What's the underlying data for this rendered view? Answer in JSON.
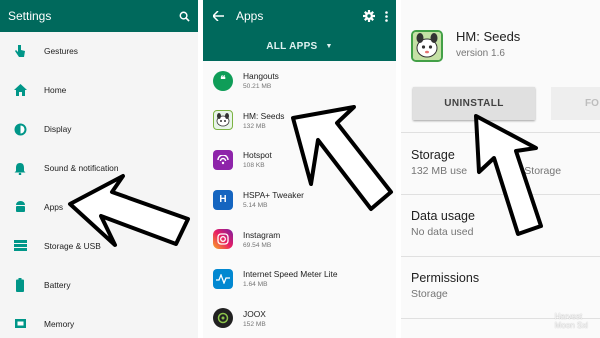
{
  "colors": {
    "toolbar": "#00695c",
    "accent": "#009688",
    "arrow_fill": "#ffffff",
    "arrow_stroke": "#000000"
  },
  "settings": {
    "title": "Settings",
    "search_icon": "search-icon",
    "items": [
      {
        "label": "Gestures",
        "icon": "gesture-hand-icon"
      },
      {
        "label": "Home",
        "icon": "home-icon"
      },
      {
        "label": "Display",
        "icon": "brightness-icon"
      },
      {
        "label": "Sound & notification",
        "icon": "bell-icon"
      },
      {
        "label": "Apps",
        "icon": "android-icon"
      },
      {
        "label": "Storage & USB",
        "icon": "storage-icon"
      },
      {
        "label": "Battery",
        "icon": "battery-icon"
      },
      {
        "label": "Memory",
        "icon": "memory-icon"
      }
    ]
  },
  "apps": {
    "title": "Apps",
    "filter": "ALL APPS",
    "items": [
      {
        "name": "Hangouts",
        "size": "50.21 MB",
        "icon": "hangouts-icon",
        "color": "#0f9d58"
      },
      {
        "name": "HM: Seeds",
        "size": "132 MB",
        "icon": "hm-seeds-icon",
        "color": "#7cb342"
      },
      {
        "name": "Hotspot",
        "size": "108 KB",
        "icon": "hotspot-icon",
        "color": "#8e24aa"
      },
      {
        "name": "HSPA+ Tweaker",
        "size": "5.14 MB",
        "icon": "hspa-tweaker-icon",
        "color": "#1565c0"
      },
      {
        "name": "Instagram",
        "size": "69.54 MB",
        "icon": "instagram-icon",
        "color": "#c13584"
      },
      {
        "name": "Internet Speed Meter Lite",
        "size": "1.64 MB",
        "icon": "speed-meter-icon",
        "color": "#0288d1"
      },
      {
        "name": "JOOX",
        "size": "152 MB",
        "icon": "joox-icon",
        "color": "#212121"
      }
    ]
  },
  "app_info": {
    "name": "HM: Seeds",
    "version": "version 1.6",
    "uninstall_label": "UNINSTALL",
    "force_stop_label": "FO",
    "storage_title": "Storage",
    "storage_value": "132 MB use",
    "storage_tail": "l Storage",
    "data_usage_title": "Data usage",
    "data_usage_value": "No data used",
    "permissions_title": "Permissions",
    "permissions_value": "Storage"
  },
  "watermark": {
    "line1": "Harvest",
    "line2": "Moon Sxl"
  }
}
